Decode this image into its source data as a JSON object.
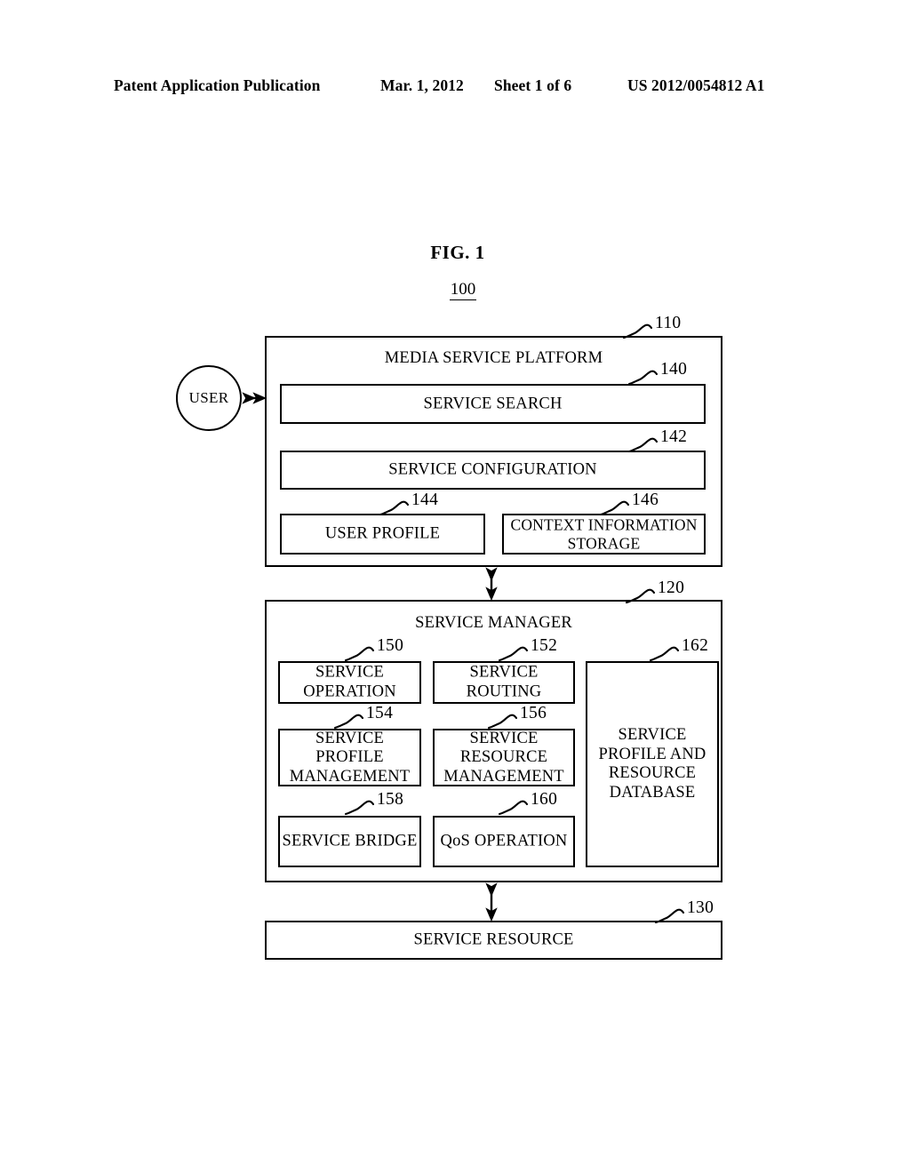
{
  "header": {
    "publication": "Patent Application Publication",
    "date": "Mar. 1, 2012",
    "sheet": "Sheet 1 of 6",
    "patent_number": "US 2012/0054812 A1"
  },
  "figure": {
    "title": "FIG. 1",
    "system_ref": "100"
  },
  "actor": {
    "label": "USER"
  },
  "platform": {
    "ref": "110",
    "title": "MEDIA SERVICE PLATFORM",
    "blocks": [
      {
        "ref": "140",
        "label": "SERVICE SEARCH"
      },
      {
        "ref": "142",
        "label": "SERVICE CONFIGURATION"
      },
      {
        "ref": "144",
        "label": "USER PROFILE"
      },
      {
        "ref": "146",
        "label": "CONTEXT INFORMATION STORAGE"
      }
    ]
  },
  "manager": {
    "ref": "120",
    "title": "SERVICE MANAGER",
    "blocks": [
      {
        "ref": "150",
        "label": "SERVICE OPERATION"
      },
      {
        "ref": "152",
        "label": "SERVICE ROUTING"
      },
      {
        "ref": "154",
        "label": "SERVICE PROFILE MANAGEMENT"
      },
      {
        "ref": "156",
        "label": "SERVICE RESOURCE MANAGEMENT"
      },
      {
        "ref": "158",
        "label": "SERVICE BRIDGE"
      },
      {
        "ref": "160",
        "label": "QoS OPERATION"
      },
      {
        "ref": "162",
        "label": "SERVICE PROFILE AND RESOURCE DATABASE"
      }
    ]
  },
  "resource": {
    "ref": "130",
    "title": "SERVICE RESOURCE"
  },
  "colors": {
    "stroke": "#000000",
    "background": "#ffffff"
  }
}
